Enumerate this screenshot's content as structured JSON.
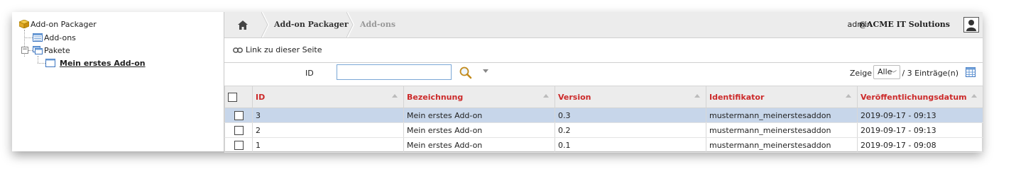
{
  "tree": {
    "root": "Add-on Packager",
    "items": [
      {
        "label": "Add-ons"
      },
      {
        "label": "Pakete",
        "expander": "−"
      },
      {
        "label": "Mein erstes Add-on"
      }
    ]
  },
  "breadcrumb": {
    "items": [
      "Add-on Packager",
      "Add-ons"
    ]
  },
  "header": {
    "user": "admin",
    "company": "@ACME IT Solutions"
  },
  "linkbar": {
    "label": "Link zu dieser Seite"
  },
  "filter": {
    "id_label": "ID",
    "id_value": "",
    "show_label": "Zeige",
    "show_value": "Alle",
    "count": "/ 3 Einträge(n)"
  },
  "table": {
    "columns": [
      "ID",
      "Bezeichnung",
      "Version",
      "Identifikator",
      "Veröffentlichungsdatum"
    ],
    "rows": [
      {
        "id": "3",
        "name": "Mein erstes Add-on",
        "version": "0.3",
        "ident": "mustermann_meinerstesaddon",
        "date": "2019-09-17 - 09:13"
      },
      {
        "id": "2",
        "name": "Mein erstes Add-on",
        "version": "0.2",
        "ident": "mustermann_meinerstesaddon",
        "date": "2019-09-17 - 09:13"
      },
      {
        "id": "1",
        "name": "Mein erstes Add-on",
        "version": "0.1",
        "ident": "mustermann_meinerstesaddon",
        "date": "2019-09-17 - 09:08"
      }
    ]
  },
  "colors": {
    "header_text": "#cc2a2a",
    "selected_row": "#c7d6ea"
  }
}
